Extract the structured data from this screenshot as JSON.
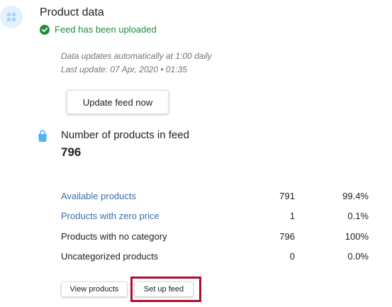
{
  "header": {
    "icon": "grid-icon",
    "title": "Product data",
    "status": {
      "icon": "check-circle-icon",
      "text": "Feed has been uploaded",
      "color": "#1e8e3e"
    }
  },
  "schedule": {
    "line1": "Data updates automatically at 1:00 daily",
    "line2": "Last update: 07 Apr, 2020 • 01:35"
  },
  "buttons": {
    "update_feed": "Update feed now",
    "view_products": "View products",
    "set_up_feed": "Set up feed"
  },
  "feed_summary": {
    "icon": "shopping-bag-icon",
    "label": "Number of products in feed",
    "value": "796"
  },
  "stats": [
    {
      "label": "Available products",
      "count": "791",
      "percent": "99.4%",
      "link": true
    },
    {
      "label": "Products with zero price",
      "count": "1",
      "percent": "0.1%",
      "link": true
    },
    {
      "label": "Products with no category",
      "count": "796",
      "percent": "100%",
      "link": false
    },
    {
      "label": "Uncategorized products",
      "count": "0",
      "percent": "0.0%",
      "link": false
    }
  ],
  "colors": {
    "link": "#3b6fa7",
    "highlight_border": "#b00d30",
    "icon_bg": "#e3f1fd",
    "icon_fg": "#a9d3f7",
    "bag": "#4fb6f0"
  }
}
